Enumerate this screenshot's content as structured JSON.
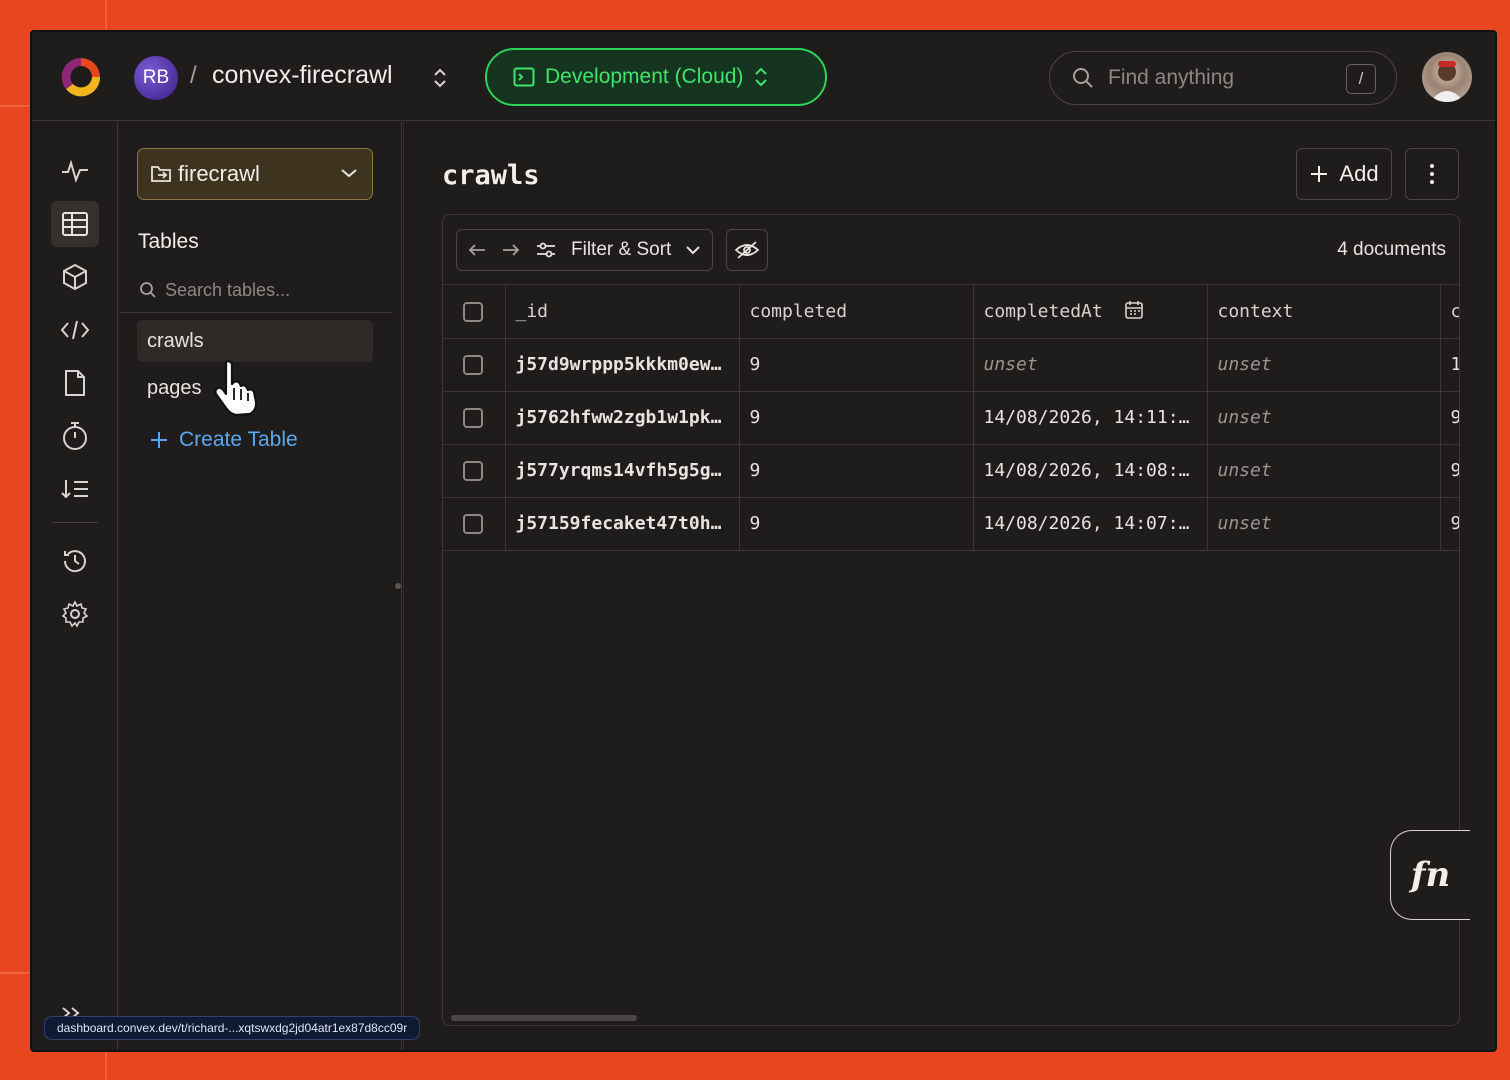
{
  "header": {
    "team_initials": "RB",
    "separator": "/",
    "project_name": "convex-firecrawl",
    "deployment": "Development (Cloud)",
    "search_placeholder": "Find anything",
    "search_shortcut": "/"
  },
  "sidebar": {
    "component": "firecrawl",
    "tables_heading": "Tables",
    "search_placeholder": "Search tables...",
    "tables": [
      "crawls",
      "pages"
    ],
    "create_label": "Create Table"
  },
  "main": {
    "title": "crawls",
    "add_label": "Add",
    "filter_label": "Filter & Sort",
    "doc_count": "4 documents",
    "columns": [
      "_id",
      "completed",
      "completedAt",
      "context",
      "c"
    ],
    "rows": [
      {
        "id": "j57d9wrppp5kkkm0ew…",
        "completed": "9",
        "completedAt": "unset",
        "context": "unset",
        "next": "1"
      },
      {
        "id": "j5762hfww2zgb1w1pk…",
        "completed": "9",
        "completedAt": "14/08/2026, 14:11:…",
        "context": "unset",
        "next": "9"
      },
      {
        "id": "j577yrqms14vfh5g5g…",
        "completed": "9",
        "completedAt": "14/08/2026, 14:08:…",
        "context": "unset",
        "next": "9"
      },
      {
        "id": "j57159fecaket47t0h…",
        "completed": "9",
        "completedAt": "14/08/2026, 14:07:…",
        "context": "unset",
        "next": "9"
      }
    ]
  },
  "fn_label": "fn",
  "status_url": "dashboard.convex.dev/t/richard-...xqtswxdg2jd04atr1ex87d8cc09r",
  "colors": {
    "background": "#e8461e",
    "app": "#1f1d1c",
    "accent_green": "#3fe46a",
    "link_blue": "#5aa7f0"
  }
}
